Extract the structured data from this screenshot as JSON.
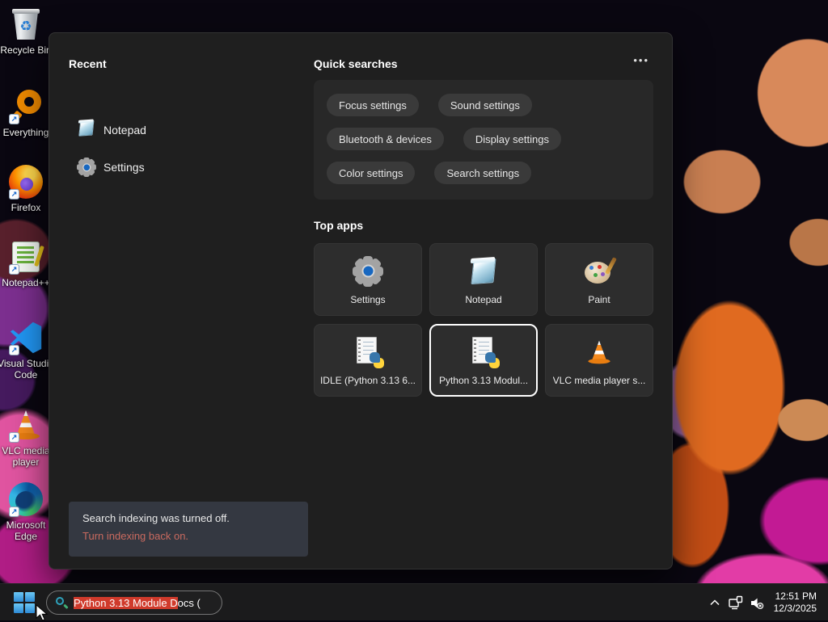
{
  "desktop": {
    "icons": [
      {
        "name": "recycle-bin",
        "label": "Recycle Bin"
      },
      {
        "name": "everything",
        "label": "Everything"
      },
      {
        "name": "firefox",
        "label": "Firefox"
      },
      {
        "name": "notepad-plus-plus",
        "label": "Notepad++"
      },
      {
        "name": "visual-studio-code",
        "label": "Visual Studio Code"
      },
      {
        "name": "vlc-media-player",
        "label": "VLC media player"
      },
      {
        "name": "microsoft-edge",
        "label": "Microsoft Edge"
      }
    ]
  },
  "icons": {
    "shortcut_arrow": "↗",
    "recycle_symbol": "♻",
    "more": "•••"
  },
  "search_panel": {
    "recent": {
      "title": "Recent",
      "items": [
        {
          "icon": "notepad-icon",
          "label": "Notepad"
        },
        {
          "icon": "settings-gear-icon",
          "label": "Settings"
        }
      ]
    },
    "quick_searches": {
      "title": "Quick searches",
      "pills": [
        "Focus settings",
        "Sound settings",
        "Bluetooth & devices",
        "Display settings",
        "Color settings",
        "Search settings"
      ]
    },
    "top_apps": {
      "title": "Top apps",
      "tiles": [
        {
          "icon": "settings-gear-icon",
          "label": "Settings",
          "selected": false
        },
        {
          "icon": "notepad-icon",
          "label": "Notepad",
          "selected": false
        },
        {
          "icon": "paint-icon",
          "label": "Paint",
          "selected": false
        },
        {
          "icon": "python-doc-icon",
          "label": "IDLE (Python 3.13 6...",
          "selected": false
        },
        {
          "icon": "python-doc-icon",
          "label": "Python 3.13 Modul...",
          "selected": true
        },
        {
          "icon": "vlc-cone-icon",
          "label": "VLC media player s...",
          "selected": false
        }
      ]
    },
    "indexing_notice": {
      "message": "Search indexing was turned off.",
      "link_text": "Turn indexing back on.",
      "link_color": "#c96a5f"
    }
  },
  "taskbar": {
    "search_box": {
      "value": "Python 3.13 Module Docs (",
      "selected_text": "Python 3.13 Module D",
      "unselected_text": "ocs (",
      "selection_color": "#d03a2b"
    },
    "tray": {
      "time": "12:51 PM",
      "date": "12/3/2025"
    }
  },
  "colors": {
    "panel_bg": "#1f1f1f",
    "quick_search_box_bg": "#282828",
    "pill_bg": "#3a3a3a",
    "tile_bg": "#2d2d2d",
    "selected_tile_border": "#ffffff",
    "taskbar_bg": "#1b1b1c",
    "notice_bg": "#343841"
  }
}
